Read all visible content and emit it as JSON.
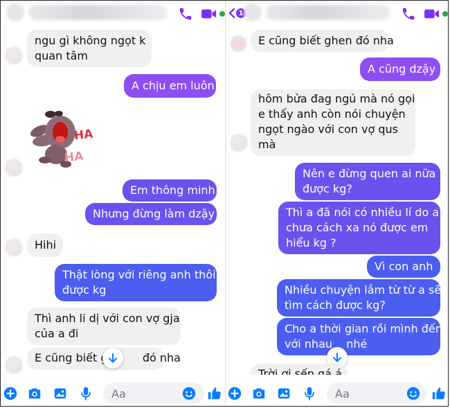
{
  "colors": {
    "messenger_blue": "#0a7cff",
    "incoming_bubble": "#f0f0f0",
    "outgoing_violet": "#8d4ef2",
    "outgoing_blue": "#4b5ef0",
    "online": "#31a24c"
  },
  "icons": {
    "call": "phone-icon",
    "video": "video-camera-icon",
    "add": "plus-circle-icon",
    "camera": "camera-icon",
    "gallery": "image-icon",
    "mic": "microphone-icon",
    "emoji": "smiley-icon",
    "like": "thumbs-up-icon",
    "scroll_down": "arrow-down-icon"
  },
  "left": {
    "messages": [
      {
        "from": "them",
        "text": [
          "ngu gì không ngọt k",
          "quan tâm"
        ]
      },
      {
        "from": "me",
        "text": [
          "A chịu em luôn"
        ]
      },
      {
        "from": "them",
        "sticker": "laughing-bear-sticker",
        "sticker_text": [
          "HA",
          "HA"
        ]
      },
      {
        "from": "me",
        "text": [
          "Em thông minh"
        ]
      },
      {
        "from": "me",
        "text": [
          "Nhưng đừng làm dzậy"
        ]
      },
      {
        "from": "them",
        "text": [
          "Hihi"
        ]
      },
      {
        "from": "me",
        "text": [
          "Thật lòng với riêng anh thôi",
          "được kg"
        ]
      },
      {
        "from": "them",
        "text": [
          "Thì anh li dị với con vợ gja",
          "của a đi"
        ]
      },
      {
        "from": "them",
        "text": [
          "E cũng biết ghen đó nha"
        ],
        "partial_left": "E cũng biết gh",
        "partial_right": "đó nha"
      }
    ],
    "composer": {
      "placeholder": "Aa"
    }
  },
  "right": {
    "back_badge": "1",
    "messages": [
      {
        "from": "them",
        "text": [
          "E cũng biết ghen đó nha"
        ]
      },
      {
        "from": "me",
        "text": [
          "A cũng dzậy"
        ]
      },
      {
        "from": "them",
        "text": [
          "hôm bửa đag ngủ mà nó gọi",
          "e thấy anh còn nói chuyện",
          "ngọt ngào với con vợ qus",
          "mà"
        ]
      },
      {
        "from": "me",
        "text": [
          "Nên e đừng quen ai nữa",
          "được kg?"
        ]
      },
      {
        "from": "me",
        "text": [
          "Thì a đã nói có nhiều lí do a",
          "chưa cách xa nó được em",
          "hiểu kg ?"
        ]
      },
      {
        "from": "me",
        "text": [
          "Vì con anh"
        ]
      },
      {
        "from": "me",
        "text": [
          "Nhiều chuyện lắm từ từ a sẽ",
          "tìm cách được kg?"
        ]
      },
      {
        "from": "me",
        "text": [
          "Cho a thời gian rồi mình đến",
          "với nhau e nhé"
        ],
        "partial_left": "với nhau",
        "partial_right": "nhé"
      },
      {
        "from": "them",
        "text": [
          "Trời ơi sến gá á"
        ]
      }
    ],
    "composer": {
      "placeholder": "Aa"
    }
  }
}
